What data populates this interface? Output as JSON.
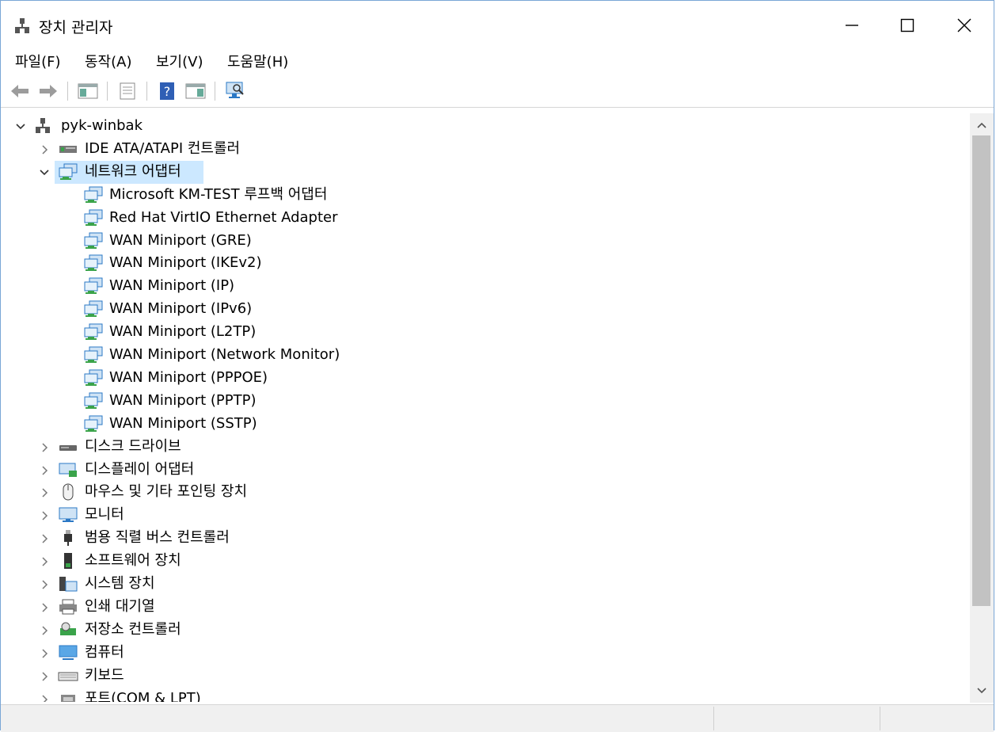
{
  "window": {
    "title": "장치 관리자"
  },
  "menu": [
    {
      "label": "파일(F)"
    },
    {
      "label": "동작(A)"
    },
    {
      "label": "보기(V)"
    },
    {
      "label": "도움말(H)"
    }
  ],
  "tree": {
    "root": "pyk-winbak",
    "rows": [
      {
        "label": "IDE ATA/ATAPI 컨트롤러",
        "icon": "ide-controller-icon",
        "level": 1,
        "expanded": false
      },
      {
        "label": "네트워크 어댑터",
        "icon": "network-adapter-icon",
        "level": 1,
        "expanded": true,
        "selected": true
      },
      {
        "label": "Microsoft KM-TEST 루프백 어댑터",
        "icon": "network-adapter-icon",
        "level": 2
      },
      {
        "label": "Red Hat VirtIO Ethernet Adapter",
        "icon": "network-adapter-icon",
        "level": 2
      },
      {
        "label": "WAN Miniport (GRE)",
        "icon": "network-adapter-icon",
        "level": 2
      },
      {
        "label": "WAN Miniport (IKEv2)",
        "icon": "network-adapter-icon",
        "level": 2
      },
      {
        "label": "WAN Miniport (IP)",
        "icon": "network-adapter-icon",
        "level": 2
      },
      {
        "label": "WAN Miniport (IPv6)",
        "icon": "network-adapter-icon",
        "level": 2
      },
      {
        "label": "WAN Miniport (L2TP)",
        "icon": "network-adapter-icon",
        "level": 2
      },
      {
        "label": "WAN Miniport (Network Monitor)",
        "icon": "network-adapter-icon",
        "level": 2
      },
      {
        "label": "WAN Miniport (PPPOE)",
        "icon": "network-adapter-icon",
        "level": 2
      },
      {
        "label": "WAN Miniport (PPTP)",
        "icon": "network-adapter-icon",
        "level": 2
      },
      {
        "label": "WAN Miniport (SSTP)",
        "icon": "network-adapter-icon",
        "level": 2
      },
      {
        "label": "디스크 드라이브",
        "icon": "disk-drive-icon",
        "level": 1,
        "expanded": false
      },
      {
        "label": "디스플레이 어댑터",
        "icon": "display-adapter-icon",
        "level": 1,
        "expanded": false
      },
      {
        "label": "마우스 및 기타 포인팅 장치",
        "icon": "mouse-icon",
        "level": 1,
        "expanded": false
      },
      {
        "label": "모니터",
        "icon": "monitor-icon",
        "level": 1,
        "expanded": false
      },
      {
        "label": "범용 직렬 버스 컨트롤러",
        "icon": "usb-icon",
        "level": 1,
        "expanded": false
      },
      {
        "label": "소프트웨어 장치",
        "icon": "software-device-icon",
        "level": 1,
        "expanded": false
      },
      {
        "label": "시스템 장치",
        "icon": "system-device-icon",
        "level": 1,
        "expanded": false
      },
      {
        "label": "인쇄 대기열",
        "icon": "printer-icon",
        "level": 1,
        "expanded": false
      },
      {
        "label": "저장소 컨트롤러",
        "icon": "storage-controller-icon",
        "level": 1,
        "expanded": false
      },
      {
        "label": "컴퓨터",
        "icon": "computer-icon",
        "level": 1,
        "expanded": false
      },
      {
        "label": "키보드",
        "icon": "keyboard-icon",
        "level": 1,
        "expanded": false
      },
      {
        "label": "포트(COM & LPT)",
        "icon": "port-icon",
        "level": 1,
        "expanded": false
      }
    ]
  },
  "colors": {
    "selection": "#cce8ff",
    "window_border": "#7aa6d6",
    "network_green": "#3aa34a",
    "network_blue": "#2b78c5"
  }
}
